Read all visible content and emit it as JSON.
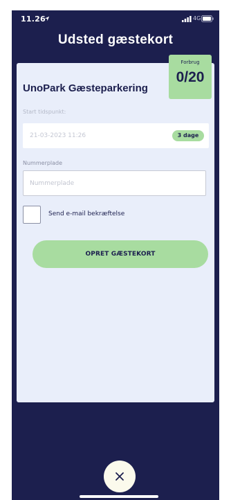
{
  "status_bar": {
    "time": "11.26",
    "network": "4G"
  },
  "header": {
    "title": "Udsted gæstekort"
  },
  "card": {
    "title": "UnoPark Gæsteparkering",
    "usage": {
      "label": "Forbrug",
      "value": "0/20"
    },
    "start_time": {
      "label": "Start tidspunkt:",
      "value": "21-03-2023 11:26",
      "duration_badge": "3 dage"
    },
    "license_plate": {
      "label": "Nummerplade",
      "placeholder": "Nummerplade",
      "value": ""
    },
    "email_confirmation": {
      "label": "Send e-mail bekræftelse",
      "checked": false
    },
    "submit_label": "OPRET GÆSTEKORT"
  },
  "icons": {
    "location": "location-arrow-icon",
    "signal": "signal-icon",
    "battery": "battery-icon",
    "close": "close-icon"
  },
  "colors": {
    "background": "#1c1f4e",
    "card": "#e9eefa",
    "accent_green": "#a8dca0",
    "close_button": "#fbfaec"
  }
}
